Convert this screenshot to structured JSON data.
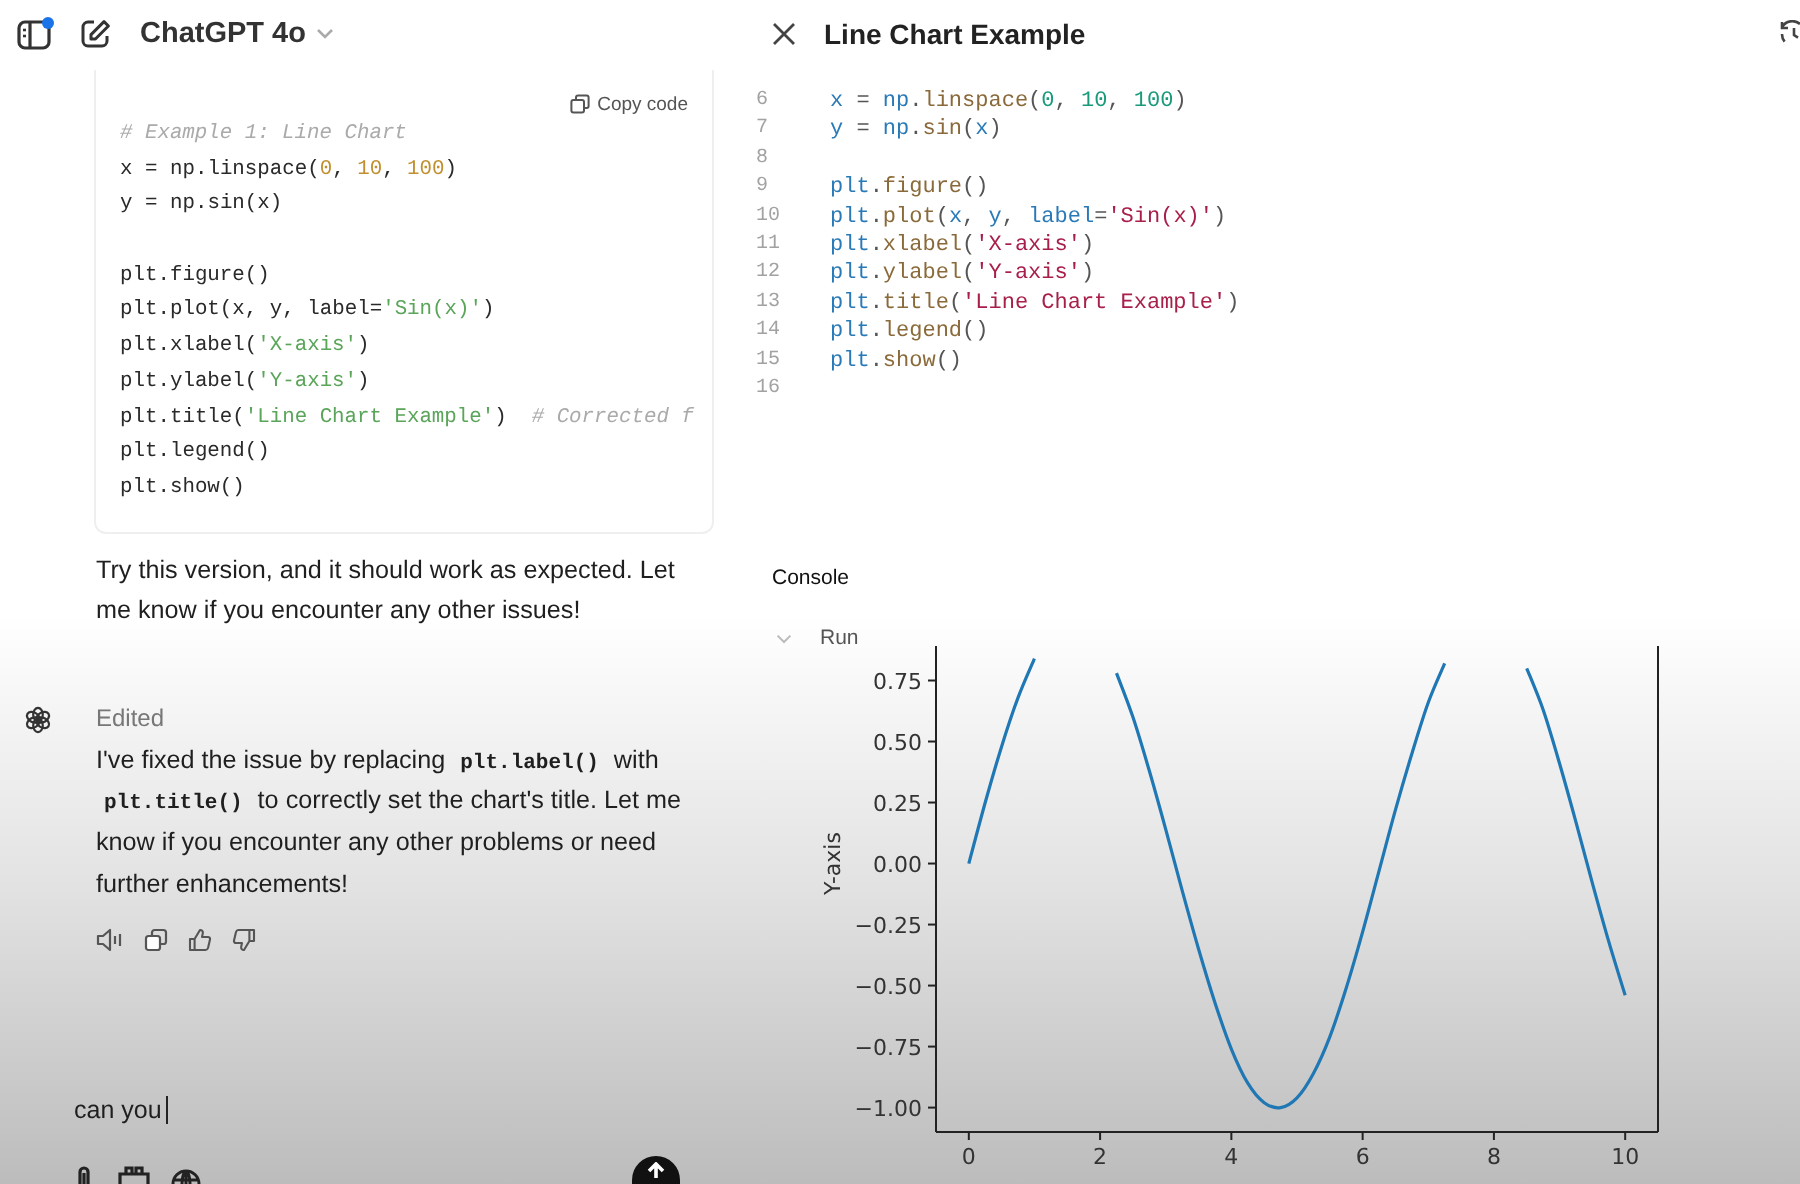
{
  "header": {
    "title": "ChatGPT 4o",
    "notification": true
  },
  "code_card": {
    "copy_label": "Copy code",
    "lines": [
      {
        "kind": "code",
        "code": "# Example 1: Line Chart"
      },
      {
        "kind": "code",
        "code": "x = np.linspace(0, 10, 100)"
      },
      {
        "kind": "code",
        "code": "y = np.sin(x)"
      },
      {
        "kind": "blank"
      },
      {
        "kind": "code",
        "code": "plt.figure()"
      },
      {
        "kind": "code",
        "code": "plt.plot(x, y, label='Sin(x)')"
      },
      {
        "kind": "code",
        "code": "plt.xlabel('X-axis')"
      },
      {
        "kind": "code",
        "code": "plt.ylabel('Y-axis')"
      },
      {
        "kind": "code",
        "code": "plt.title('Line Chart Example')  # Corrected f"
      },
      {
        "kind": "code",
        "code": "plt.legend()"
      },
      {
        "kind": "code",
        "code": "plt.show()"
      }
    ]
  },
  "message": "Try this version, and it should work as expected. Let me know if you encounter any other issues!",
  "reply": {
    "status": "Edited",
    "parts": [
      {
        "kind": "text",
        "text": "I've fixed the issue by replacing "
      },
      {
        "kind": "code",
        "text": "plt.label()"
      },
      {
        "kind": "text",
        "text": " with "
      },
      {
        "kind": "code",
        "text": "plt.title()"
      },
      {
        "kind": "text",
        "text": " to correctly set the chart's title. Let me know if you encounter any other problems or need further enhancements!"
      }
    ]
  },
  "composer": {
    "value": "can you"
  },
  "canvas": {
    "title": "Line Chart Example",
    "lines": [
      {
        "number": "6",
        "code": "x = np.linspace(0, 10, 100)"
      },
      {
        "number": "7",
        "code": "y = np.sin(x)"
      },
      {
        "number": "8"
      },
      {
        "number": "9",
        "code": "plt.figure()"
      },
      {
        "number": "10",
        "code": "plt.plot(x, y, label='Sin(x)')"
      },
      {
        "number": "11",
        "code": "plt.xlabel('X-axis')"
      },
      {
        "number": "12",
        "code": "plt.ylabel('Y-axis')"
      },
      {
        "number": "13",
        "code": "plt.title('Line Chart Example')"
      },
      {
        "number": "14",
        "code": "plt.legend()"
      },
      {
        "number": "15",
        "code": "plt.show()"
      },
      {
        "number": "16"
      }
    ]
  },
  "console": {
    "title": "Console",
    "run_label": "Run",
    "chart_data": {
      "type": "line",
      "ylabel": "Y-axis",
      "x": [
        0,
        0.25,
        0.5,
        0.75,
        1,
        1.25,
        1.5,
        1.75,
        2,
        2.25,
        2.5,
        2.75,
        3,
        3.25,
        3.5,
        3.75,
        4,
        4.25,
        4.5,
        4.75,
        5,
        5.25,
        5.5,
        5.75,
        6,
        6.25,
        6.5,
        6.75,
        7,
        7.25,
        7.5,
        7.75,
        8,
        8.25,
        8.5,
        8.75,
        9,
        9.25,
        9.5,
        9.75,
        10
      ],
      "series": [
        {
          "color": "#1f77b4",
          "values": [
            0,
            0.25,
            0.48,
            0.68,
            0.84,
            null,
            null,
            null,
            null,
            0.78,
            0.6,
            0.38,
            0.14,
            -0.11,
            -0.35,
            -0.57,
            -0.76,
            -0.9,
            -0.98,
            -1,
            -0.96,
            -0.86,
            -0.71,
            -0.51,
            -0.28,
            -0.03,
            0.22,
            0.45,
            0.66,
            0.82,
            null,
            null,
            null,
            null,
            0.8,
            0.63,
            0.41,
            0.17,
            -0.08,
            -0.32,
            -0.54
          ]
        }
      ],
      "xlim": [
        -0.5,
        10.5
      ],
      "ylim": [
        -1.1,
        0.875
      ],
      "xticks": [
        0,
        2,
        4,
        6,
        8,
        10
      ],
      "yticks": [
        {
          "value": 0.75,
          "label": "0.75"
        },
        {
          "value": 0.5,
          "label": "0.50"
        },
        {
          "value": 0.25,
          "label": "0.25"
        },
        {
          "value": 0,
          "label": "0.00"
        },
        {
          "value": -0.25,
          "label": "−0.25"
        },
        {
          "value": -0.5,
          "label": "−0.50"
        },
        {
          "value": -0.75,
          "label": "−0.75"
        },
        {
          "value": -1,
          "label": "−1.00"
        }
      ]
    }
  }
}
